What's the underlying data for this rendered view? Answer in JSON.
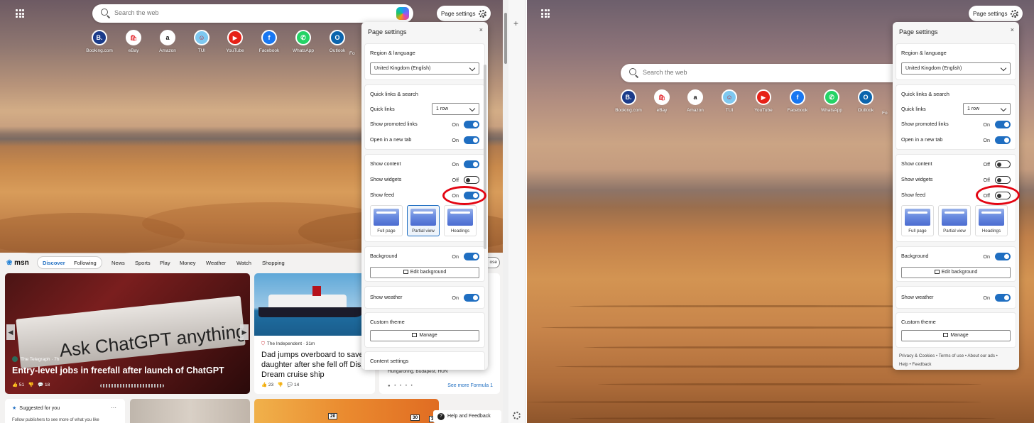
{
  "left": {
    "search": {
      "placeholder": "Search the web"
    },
    "page_settings_button": "Page settings",
    "quick_links": [
      {
        "label": "Booking.com",
        "glyph": "B.",
        "color": "#1a3b8a"
      },
      {
        "label": "eBay",
        "glyph": "🛍",
        "color": "#ffffff"
      },
      {
        "label": "Amazon",
        "glyph": "a",
        "color": "#ffffff"
      },
      {
        "label": "TUI",
        "glyph": "☺",
        "color": "#7ec8f0"
      },
      {
        "label": "YouTube",
        "glyph": "▶",
        "color": "#e62117"
      },
      {
        "label": "Facebook",
        "glyph": "f",
        "color": "#1877f2"
      },
      {
        "label": "WhatsApp",
        "glyph": "✆",
        "color": "#25d366"
      },
      {
        "label": "Outlook",
        "glyph": "O",
        "color": "#0a64ad"
      },
      {
        "label": "Fo",
        "glyph": "",
        "color": "#888888"
      }
    ],
    "panel": {
      "title": "Page settings",
      "close": "×",
      "region_heading": "Region & language",
      "region_value": "United Kingdom (English)",
      "quick_heading": "Quick links & search",
      "quick_links_label": "Quick links",
      "quick_links_value": "1 row",
      "show_promoted": "Show promoted links",
      "show_promoted_state": "On",
      "open_new_tab": "Open in a new tab",
      "open_new_tab_state": "On",
      "show_content": "Show content",
      "show_content_state": "On",
      "show_widgets": "Show widgets",
      "show_widgets_state": "Off",
      "show_feed": "Show feed",
      "show_feed_state": "On",
      "layouts": [
        "Full page",
        "Partial view",
        "Headings"
      ],
      "background": "Background",
      "background_state": "On",
      "edit_background": "Edit background",
      "show_weather": "Show weather",
      "show_weather_state": "On",
      "custom_theme": "Custom theme",
      "manage": "Manage",
      "content_settings": "Content settings"
    },
    "feed": {
      "logo": "msn",
      "tabs": [
        "Discover",
        "Following"
      ],
      "nav": [
        "News",
        "Sports",
        "Play",
        "Money",
        "Weather",
        "Watch",
        "Shopping"
      ],
      "close_pill": "ose",
      "hero": {
        "image_text": "Ask ChatGPT anything",
        "source": "The Telegraph · 7h",
        "title": "Entry-level jobs in freefall after launch of ChatGPT",
        "likes": "51",
        "comments": "18"
      },
      "ship": {
        "source": "The Independent · 31m",
        "title": "Dad jumps overboard to save daughter after she fell off Disney Dream cruise ship",
        "likes": "23",
        "comments": "14"
      },
      "f1": {
        "location": "Hungaroring, Budapest, HUN",
        "more": "See more Formula 1",
        "pager": "● • • • •"
      },
      "suggested": {
        "title": "Suggested for you",
        "desc": "Follow publishers to see more of what you like",
        "menu": "···"
      },
      "map_numbers": [
        "20",
        "30",
        "3"
      ],
      "help": "Help and Feedback"
    }
  },
  "right": {
    "search": {
      "placeholder": "Search the web"
    },
    "page_settings_button": "Page settings",
    "quick_links": [
      {
        "label": "Booking.com",
        "glyph": "B.",
        "color": "#1a3b8a"
      },
      {
        "label": "eBay",
        "glyph": "🛍",
        "color": "#ffffff"
      },
      {
        "label": "Amazon",
        "glyph": "a",
        "color": "#ffffff"
      },
      {
        "label": "TUI",
        "glyph": "☺",
        "color": "#7ec8f0"
      },
      {
        "label": "YouTube",
        "glyph": "▶",
        "color": "#e62117"
      },
      {
        "label": "Facebook",
        "glyph": "f",
        "color": "#1877f2"
      },
      {
        "label": "WhatsApp",
        "glyph": "✆",
        "color": "#25d366"
      },
      {
        "label": "Outlook",
        "glyph": "O",
        "color": "#0a64ad"
      },
      {
        "label": "Fo",
        "glyph": "",
        "color": "#888888"
      }
    ],
    "panel": {
      "title": "Page settings",
      "close": "×",
      "region_heading": "Region & language",
      "region_value": "United Kingdom (English)",
      "quick_heading": "Quick links & search",
      "quick_links_label": "Quick links",
      "quick_links_value": "1 row",
      "show_promoted": "Show promoted links",
      "show_promoted_state": "On",
      "open_new_tab": "Open in a new tab",
      "open_new_tab_state": "On",
      "show_content": "Show content",
      "show_content_state": "Off",
      "show_widgets": "Show widgets",
      "show_widgets_state": "Off",
      "show_feed": "Show feed",
      "show_feed_state": "Off",
      "layouts": [
        "Full page",
        "Partial view",
        "Headings"
      ],
      "background": "Background",
      "background_state": "On",
      "edit_background": "Edit background",
      "show_weather": "Show weather",
      "show_weather_state": "On",
      "custom_theme": "Custom theme",
      "manage": "Manage",
      "footer_links": [
        "Privacy & Cookies",
        "Terms of use",
        "About our ads",
        "Help",
        "Feedback"
      ]
    }
  },
  "colors": {
    "accent": "#1f6ec1",
    "highlight": "#e30613"
  }
}
